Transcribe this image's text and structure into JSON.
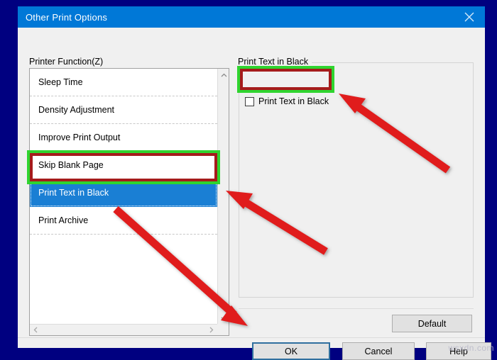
{
  "window": {
    "title": "Other Print Options",
    "close_icon": "close-x-icon"
  },
  "left_panel": {
    "label": "Printer Function(Z)",
    "items": [
      {
        "label": "Sleep Time",
        "selected": false
      },
      {
        "label": "Density Adjustment",
        "selected": false
      },
      {
        "label": "Improve Print Output",
        "selected": false
      },
      {
        "label": "Skip Blank Page",
        "selected": false
      },
      {
        "label": "Print Text in Black",
        "selected": true
      },
      {
        "label": "Print Archive",
        "selected": false
      }
    ],
    "scrollbar": {
      "up_icon": "chevron-up-icon",
      "down_icon": "chevron-down-icon",
      "left_icon": "chevron-left-icon",
      "right_icon": "chevron-right-icon"
    }
  },
  "right_panel": {
    "group_title": "Print Text in Black",
    "checkbox": {
      "label": "Print Text in Black",
      "checked": false
    },
    "default_button": "Default"
  },
  "footer": {
    "ok": "OK",
    "cancel": "Cancel",
    "help": "Help"
  },
  "annotations": {
    "highlight_color_outer": "#2fd42f",
    "highlight_color_inner": "#a51b1b",
    "arrow_color": "#e01b1b",
    "arrows": [
      {
        "name": "arrow-to-checkbox"
      },
      {
        "name": "arrow-to-list-item"
      },
      {
        "name": "arrow-to-ok-button"
      }
    ]
  },
  "watermark": "wsxdn.com",
  "theme": {
    "titlebar_blue": "#0078d7",
    "desktop_navy": "#000080",
    "selection_blue": "#1a7fd4",
    "dialog_face": "#f0f0f0"
  }
}
